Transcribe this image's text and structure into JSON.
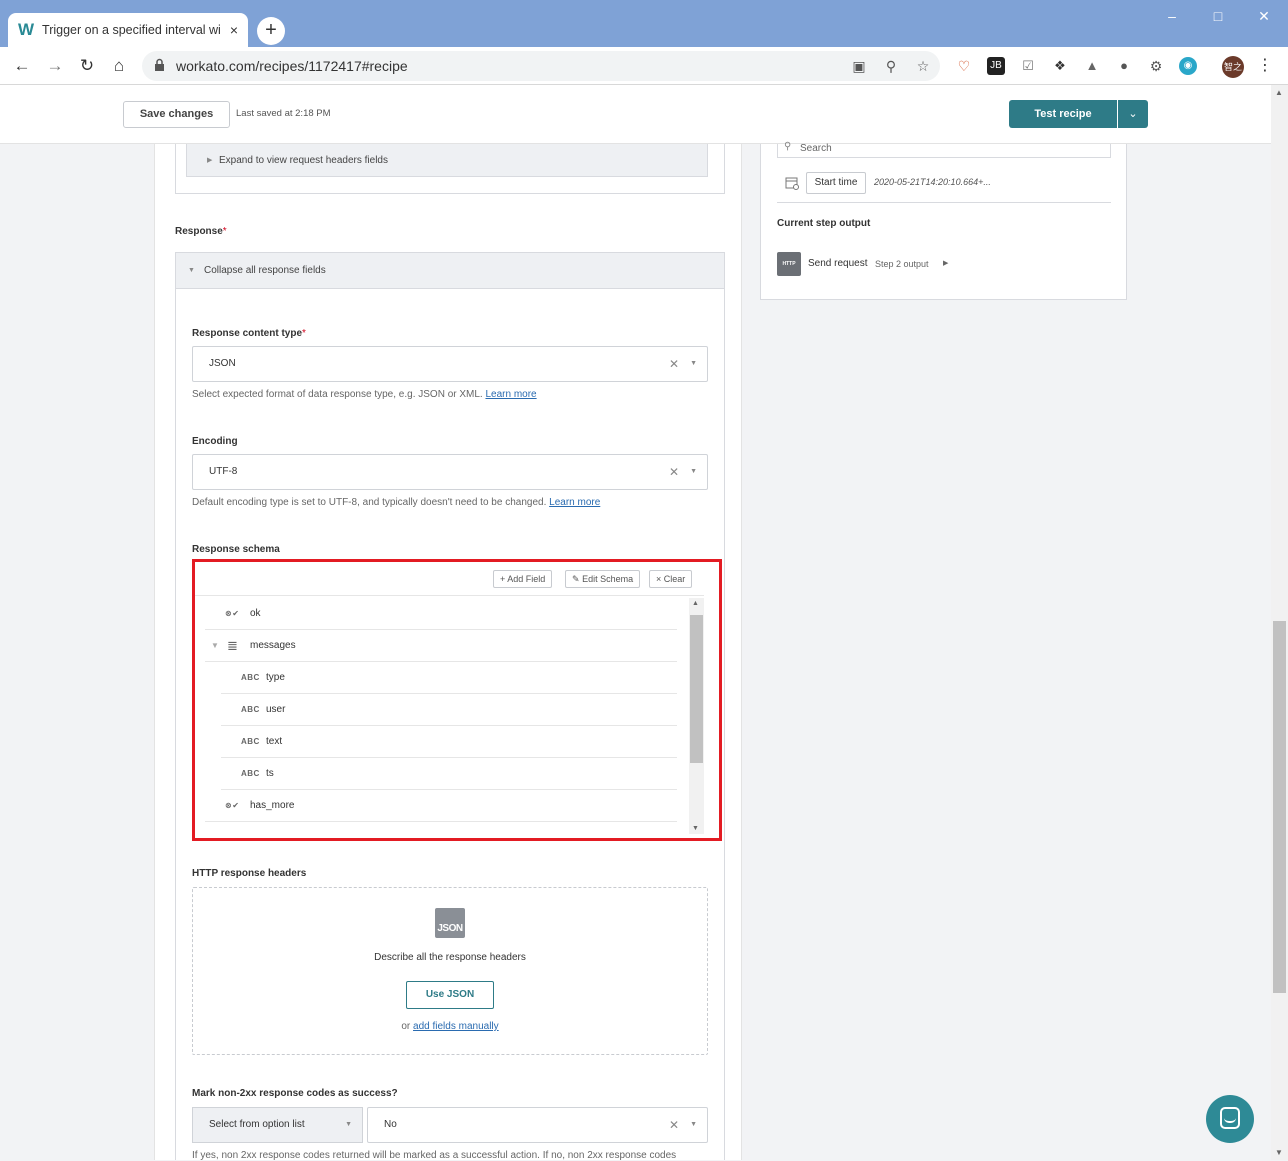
{
  "browser": {
    "tab_title": "Trigger on a specified interval wi",
    "tab_icon_letter": "W",
    "tab_close": "×",
    "new_tab": "+",
    "url": "workato.com/recipes/1172417#recipe",
    "profile": "智之"
  },
  "header": {
    "save_label": "Save changes",
    "last_saved": "Last saved at 2:18 PM",
    "test_label": "Test recipe"
  },
  "request_headers": {
    "expand_label": "Expand to view request headers fields"
  },
  "response": {
    "label": "Response",
    "required_mark": "*",
    "collapse_label": "Collapse all response fields",
    "content_type": {
      "label": "Response content type",
      "value": "JSON",
      "hint": "Select expected format of data response type, e.g. JSON or XML.",
      "learn_more": "Learn more"
    },
    "encoding": {
      "label": "Encoding",
      "value": "UTF-8",
      "hint": "Default encoding type is set to UTF-8, and typically doesn't need to be changed.",
      "learn_more": "Learn more"
    },
    "schema": {
      "label": "Response schema",
      "add_field": "+ Add Field",
      "edit_schema": "Edit Schema",
      "clear": "× Clear",
      "fields": [
        {
          "name": "ok",
          "icon": "boolean-icon",
          "glyph": "⊗✔"
        },
        {
          "name": "messages",
          "icon": "array-icon",
          "glyph": "≣"
        },
        {
          "name": "type",
          "icon": "string-icon",
          "glyph": "ABC"
        },
        {
          "name": "user",
          "icon": "string-icon",
          "glyph": "ABC"
        },
        {
          "name": "text",
          "icon": "string-icon",
          "glyph": "ABC"
        },
        {
          "name": "ts",
          "icon": "string-icon",
          "glyph": "ABC"
        },
        {
          "name": "has_more",
          "icon": "boolean-icon",
          "glyph": "⊗✔"
        }
      ]
    },
    "http_headers": {
      "label": "HTTP response headers",
      "json_badge": "JSON",
      "description": "Describe all the response headers",
      "use_json": "Use JSON",
      "or": "or",
      "add_manually": "add fields manually"
    },
    "non_2xx": {
      "label": "Mark non-2xx response codes as success?",
      "option_list": "Select from option list",
      "value": "No",
      "hint": "If yes, non 2xx response codes returned will be marked as a successful action. If no, non 2xx response codes"
    }
  },
  "right_panel": {
    "search_placeholder": "Search",
    "start_time_label": "Start time",
    "start_time_value": "2020-05-21T14:20:10.664+...",
    "current_step_output": "Current step output",
    "http_badge": "HTTP",
    "send_request": "Send request",
    "step_output": "Step 2 output"
  },
  "colors": {
    "accent": "#2e7b87",
    "highlight_box": "#e31b23",
    "tabbar": "#7fa2d6"
  }
}
